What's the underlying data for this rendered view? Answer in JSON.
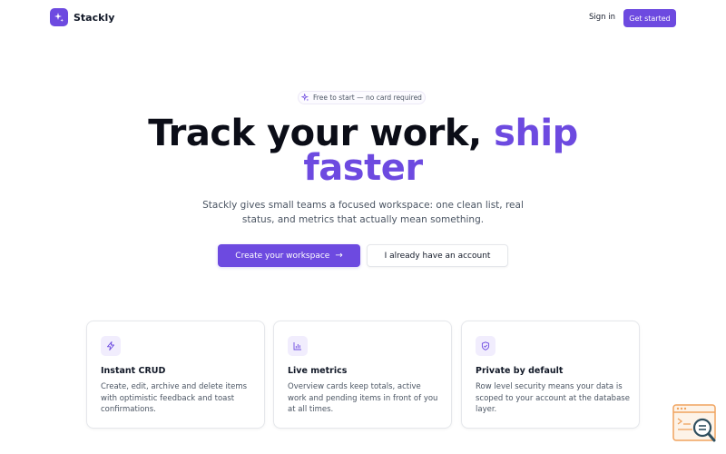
{
  "brand": {
    "name": "Stackly",
    "logo_icon": "sparkles-icon"
  },
  "nav": {
    "signin_label": "Sign in",
    "cta_label": "Get started"
  },
  "badge": {
    "text": "Free to start — no card required",
    "icon": "sparkles-icon"
  },
  "hero": {
    "title_main": "Track your work,",
    "title_accent_1": "ship",
    "title_accent_2": "faster",
    "subtitle": "Stackly gives small teams a focused workspace: one clean list, real status, and metrics that actually mean something."
  },
  "actions": {
    "primary_label": "Create your workspace",
    "primary_icon": "arrow-right-icon",
    "secondary_label": "I already have an account"
  },
  "features": [
    {
      "title": "Instant CRUD",
      "text": "Create, edit, archive and delete items with optimistic feedback and toast confirmations.",
      "icon": "lightning-icon"
    },
    {
      "title": "Live metrics",
      "text": "Overview cards keep totals, active work and pending items in front of you at all times.",
      "icon": "bar-chart-icon"
    },
    {
      "title": "Private by default",
      "text": "Row level security means your data is scoped to your account at the database layer.",
      "icon": "shield-icon"
    }
  ],
  "colors": {
    "accent": "#6d4ae0",
    "text": "#111827",
    "muted": "#4b5563",
    "border": "#e5e7eb"
  }
}
